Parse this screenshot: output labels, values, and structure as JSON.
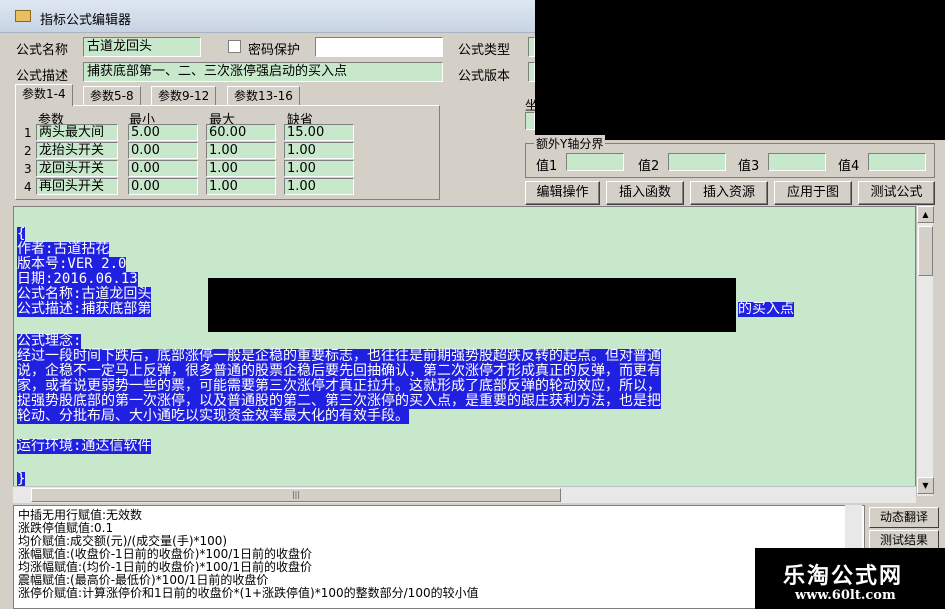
{
  "window": {
    "title": "指标公式编辑器"
  },
  "form": {
    "name_label": "公式名称",
    "name_value": "古道龙回头",
    "password_label": "密码保护",
    "desc_label": "公式描述",
    "desc_value": "捕获底部第一、二、三次涨停强启动的买入点",
    "type_label": "公式类型",
    "version_label": "公式版本"
  },
  "tabs": [
    "参数1-4",
    "参数5-8",
    "参数9-12",
    "参数13-16"
  ],
  "params": {
    "headers": [
      "参数",
      "最小",
      "最大",
      "缺省"
    ],
    "rows": [
      {
        "num": "1",
        "name": "两头最大间",
        "min": "5.00",
        "max": "60.00",
        "def": "15.00"
      },
      {
        "num": "2",
        "name": "龙抬头开关",
        "min": "0.00",
        "max": "1.00",
        "def": "1.00"
      },
      {
        "num": "3",
        "name": "龙回头开关",
        "min": "0.00",
        "max": "1.00",
        "def": "1.00"
      },
      {
        "num": "4",
        "name": "再回头开关",
        "min": "0.00",
        "max": "1.00",
        "def": "1.00"
      }
    ]
  },
  "axis_calc": {
    "title": "额外Y轴分界",
    "labels": [
      "值1",
      "值2",
      "值3",
      "值4"
    ]
  },
  "buttons": [
    "编辑操作",
    "插入函数",
    "插入资源",
    "应用于图",
    "测试公式"
  ],
  "editor": {
    "lines": [
      "{",
      "作者:古道拈花",
      "版本号:VER 2.0",
      "日期:2016.06.13",
      "公式名称:古道龙回头",
      "公式描述:捕获底部第",
      "的买入点",
      "公式理念:",
      "经过一段时间下跌后，底部涨停一般是企稳的重要标志，也往往是前期强势股超跌反转的起点。但对普通",
      "说，企稳不一定马上反弹，很多普通的股票企稳后要先回抽确认，第二次涨停才形成真正的反弹，而更有",
      "家，或者说更弱势一些的票，可能需要第三次涨停才真正拉升。这就形成了底部反弹的轮动效应，所以，",
      "捉强势股底部的第一次涨停，以及普通股的第二、第三次涨停的买入点，是重要的跟庄获利方法，也是把",
      "轮动、分批布局、大小通吃以实现资金效率最大化的有效手段。",
      "运行环境:通达信软件",
      "}"
    ]
  },
  "messages": [
    "中插无用行赋值:无效数",
    "涨跌停值赋值:0.1",
    "均价赋值:成交额(元)/(成交量(手)*100)",
    "涨幅赋值:(收盘价-1日前的收盘价)*100/1日前的收盘价",
    "均涨幅赋值:(均价-1日前的收盘价)*100/1日前的收盘价",
    "震幅赋值:(最高价-最低价)*100/1日前的收盘价",
    "涨停价赋值:计算涨停价和1日前的收盘价*(1+涨跌停值)*100的整数部分/100的较小值"
  ],
  "side_buttons": [
    "动态翻译",
    "测试结果"
  ],
  "watermark": {
    "brand": "乐淘公式网",
    "url": "www.60lt.com"
  }
}
